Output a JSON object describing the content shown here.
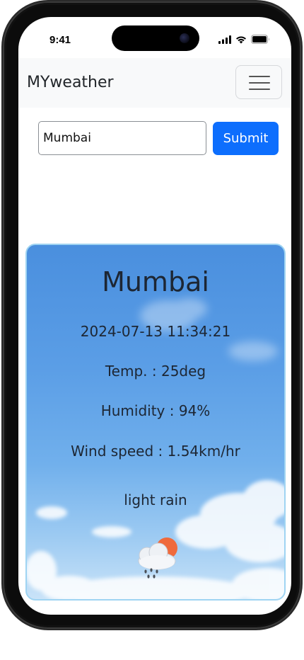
{
  "status_bar": {
    "time": "9:41"
  },
  "navbar": {
    "brand": "MYweather",
    "toggler_icon": "hamburger-menu-icon"
  },
  "search": {
    "value": "Mumbai",
    "submit_label": "Submit"
  },
  "weather": {
    "city": "Mumbai",
    "datetime": "2024-07-13 11:34:21",
    "temperature": "Temp. : 25deg",
    "humidity": "Humidity : 94%",
    "wind_speed": "Wind speed : 1.54km/hr",
    "description": "light rain",
    "icon": "sun-cloud-rain-icon"
  },
  "colors": {
    "accent": "#0d6efd",
    "navbar_bg": "#f8f9fa",
    "card_border": "#9fd4f2"
  }
}
